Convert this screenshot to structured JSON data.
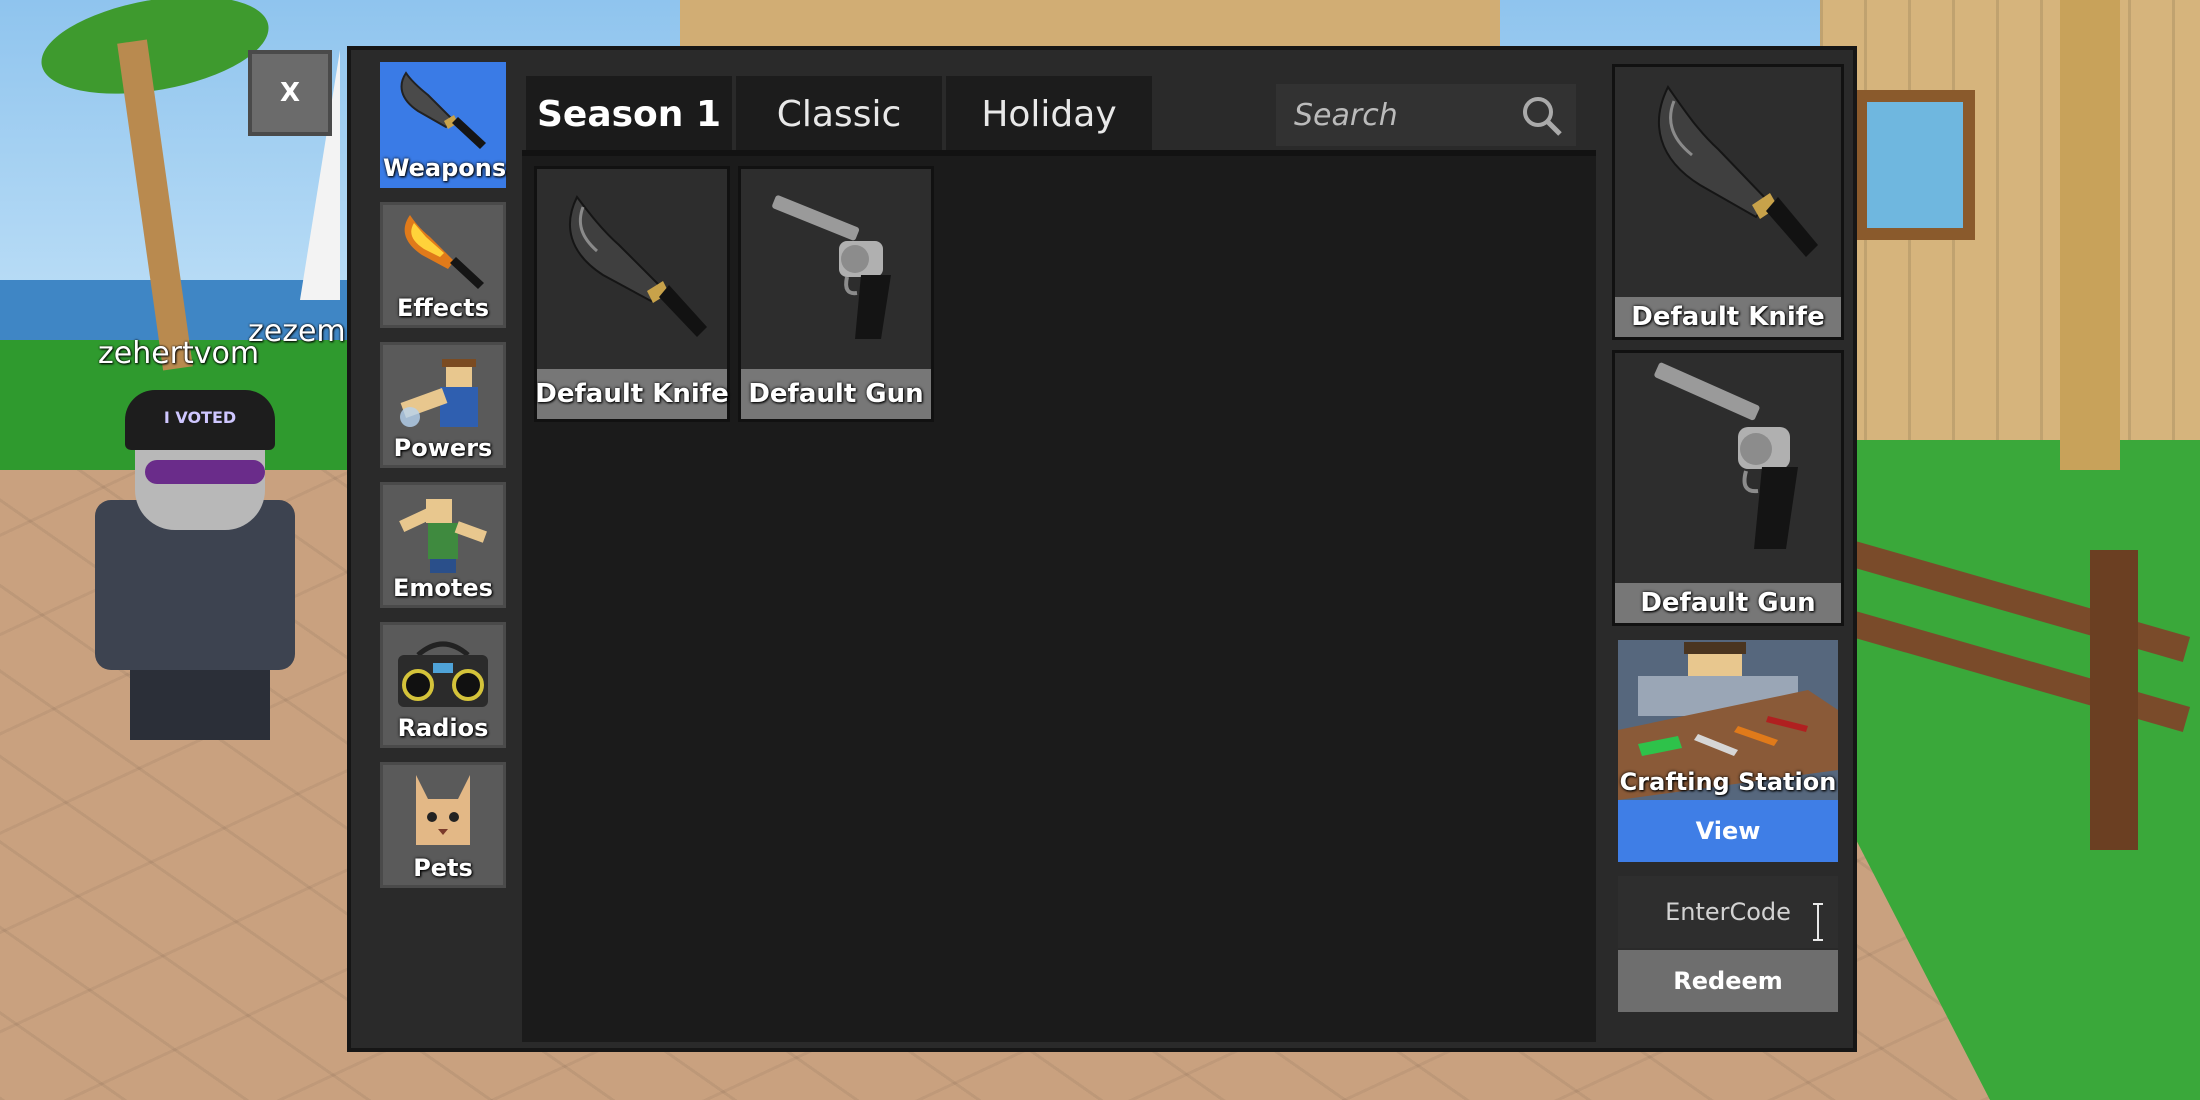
{
  "close_button": {
    "label": "X"
  },
  "categories": [
    {
      "label": "Weapons",
      "icon": "knife-icon",
      "active": true
    },
    {
      "label": "Effects",
      "icon": "flame-knife-icon",
      "active": false
    },
    {
      "label": "Powers",
      "icon": "power-figure-icon",
      "active": false
    },
    {
      "label": "Emotes",
      "icon": "dab-figure-icon",
      "active": false
    },
    {
      "label": "Radios",
      "icon": "boombox-icon",
      "active": false
    },
    {
      "label": "Pets",
      "icon": "cat-icon",
      "active": false
    }
  ],
  "tabs": [
    {
      "label": "Season 1",
      "active": true
    },
    {
      "label": "Classic",
      "active": false
    },
    {
      "label": "Holiday",
      "active": false
    }
  ],
  "search": {
    "placeholder": "Search"
  },
  "items": [
    {
      "name": "Default Knife",
      "icon": "knife-icon"
    },
    {
      "name": "Default Gun",
      "icon": "revolver-icon"
    }
  ],
  "equipped": {
    "knife": {
      "name": "Default Knife",
      "icon": "knife-icon"
    },
    "gun": {
      "name": "Default Gun",
      "icon": "revolver-icon"
    }
  },
  "crafting": {
    "label": "Crafting Station",
    "view_label": "View"
  },
  "code": {
    "placeholder": "EnterCode",
    "redeem_label": "Redeem"
  },
  "scene": {
    "nametags": [
      "zehertvom",
      "zezem"
    ],
    "hat_text": "I VOTED"
  },
  "colors": {
    "accent": "#3a7be6",
    "panel": "#2a2a2a",
    "content": "#1b1b1b",
    "item_label": "#777777"
  }
}
